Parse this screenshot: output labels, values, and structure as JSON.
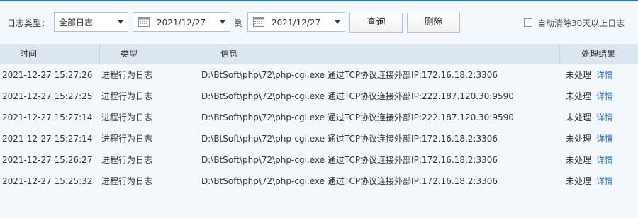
{
  "filter": {
    "type_label": "日志类型：",
    "type_select_value": "全部日志",
    "date_from": "2021/12/27",
    "to_label": "到",
    "date_to": "2021/12/27",
    "query_button": "查询",
    "delete_button": "删除",
    "auto_clear_label": "自动清除30天以上日志",
    "auto_clear_checked": false
  },
  "table": {
    "columns": [
      "时间",
      "类型",
      "信息",
      "处理结果"
    ],
    "detail_label": "详情",
    "rows": [
      {
        "time": "2021-12-27 15:27:26",
        "type": "进程行为日志",
        "info": "D:\\BtSoft\\php\\72\\php-cgi.exe 通过TCP协议连接外部IP:172.16.18.2:3306",
        "result": "未处理"
      },
      {
        "time": "2021-12-27 15:27:25",
        "type": "进程行为日志",
        "info": "D:\\BtSoft\\php\\72\\php-cgi.exe 通过TCP协议连接外部IP:222.187.120.30:9590",
        "result": "未处理"
      },
      {
        "time": "2021-12-27 15:27:14",
        "type": "进程行为日志",
        "info": "D:\\BtSoft\\php\\72\\php-cgi.exe 通过TCP协议连接外部IP:222.187.120.30:9590",
        "result": "未处理"
      },
      {
        "time": "2021-12-27 15:27:14",
        "type": "进程行为日志",
        "info": "D:\\BtSoft\\php\\72\\php-cgi.exe 通过TCP协议连接外部IP:172.16.18.2:3306",
        "result": "未处理"
      },
      {
        "time": "2021-12-27 15:26:27",
        "type": "进程行为日志",
        "info": "D:\\BtSoft\\php\\72\\php-cgi.exe 通过TCP协议连接外部IP:172.16.18.2:3306",
        "result": "未处理"
      },
      {
        "time": "2021-12-27 15:25:32",
        "type": "进程行为日志",
        "info": "D:\\BtSoft\\php\\72\\php-cgi.exe 通过TCP协议连接外部IP:172.16.18.2:3306",
        "result": "未处理"
      }
    ]
  },
  "colors": {
    "accent": "#1a7bd4",
    "link": "#1565c0",
    "header_bg": "#dce6ee",
    "page_bg": "#f3f8fc"
  },
  "icons": {
    "calendar": "calendar-icon",
    "dropdown": "chevron-down-icon"
  }
}
